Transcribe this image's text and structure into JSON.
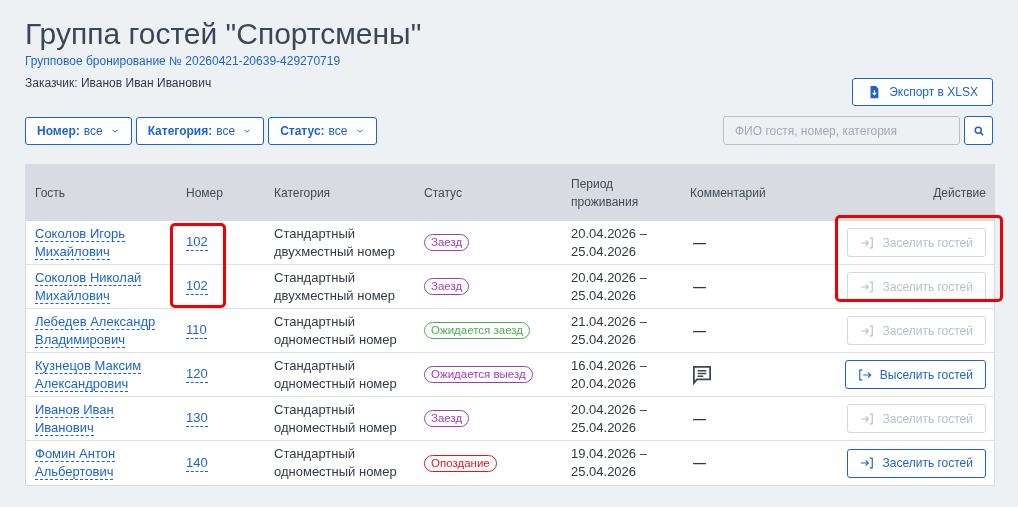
{
  "title": "Группа гостей \"Спортсмены\"",
  "booking_link": "Групповое бронирование № 20260421-20639-429270719",
  "customer": "Заказчик: Иванов Иван Иванович",
  "export_button": "Экспорт в XLSX",
  "filters": [
    {
      "label": "Номер:",
      "value": "все"
    },
    {
      "label": "Категория:",
      "value": "все"
    },
    {
      "label": "Статус:",
      "value": "все"
    }
  ],
  "search": {
    "placeholder": "ФИО гостя, номер, категория"
  },
  "table": {
    "columns": [
      "Гость",
      "Номер",
      "Категория",
      "Статус",
      "Период проживания",
      "Комментарий",
      "Действие"
    ],
    "rows": [
      {
        "guest": "Соколов Игорь Михайлович",
        "room": "102",
        "category": "Стандартный двухместный номер",
        "status": "Заезд",
        "color": "#a23cbf",
        "period": "20.04.2026 – 25.04.2026",
        "comment": {
          "kind": "dash",
          "text": "—"
        },
        "action": {
          "kind": "checkin",
          "label": "Заселить гостей",
          "disabled": true
        },
        "room_highlighted": true,
        "action_highlighted": true
      },
      {
        "guest": "Соколов Николай Михайлович",
        "room": "102",
        "category": "Стандартный двухместный номер",
        "status": "Заезд",
        "color": "#a23cbf",
        "period": "20.04.2026 – 25.04.2026",
        "comment": {
          "kind": "dash",
          "text": "—"
        },
        "action": {
          "kind": "checkin",
          "label": "Заселить гостей",
          "disabled": true
        },
        "room_highlighted": true,
        "action_highlighted": true
      },
      {
        "guest": "Лебедев Александр Владимирович",
        "room": "110",
        "category": "Стандартный одноместный номер",
        "status": "Ожидается заезд",
        "color": "#4caf50",
        "period": "21.04.2026 – 25.04.2026",
        "comment": {
          "kind": "dash",
          "text": "—"
        },
        "action": {
          "kind": "checkin",
          "label": "Заселить гостей",
          "disabled": true
        },
        "room_highlighted": false,
        "action_highlighted": false
      },
      {
        "guest": "Кузнецов Максим Александрович",
        "room": "120",
        "category": "Стандартный одноместный номер",
        "status": "Ожидается выезд",
        "color": "#a23cbf",
        "period": "16.04.2026 – 20.04.2026",
        "comment": {
          "kind": "icon"
        },
        "action": {
          "kind": "checkout",
          "label": "Выселить гостей",
          "disabled": false
        },
        "room_highlighted": false,
        "action_highlighted": false
      },
      {
        "guest": "Иванов Иван Иванович",
        "room": "130",
        "category": "Стандартный одноместный номер",
        "status": "Заезд",
        "color": "#a23cbf",
        "period": "20.04.2026 – 25.04.2026",
        "comment": {
          "kind": "dash",
          "text": "—"
        },
        "action": {
          "kind": "checkin",
          "label": "Заселить гостей",
          "disabled": true
        },
        "room_highlighted": false,
        "action_highlighted": false
      },
      {
        "guest": "Фомин Антон Альбертович",
        "room": "140",
        "category": "Стандартный одноместный номер",
        "status": "Опоздание",
        "color": "#e5161b",
        "period": "19.04.2026 – 25.04.2026",
        "comment": {
          "kind": "dash",
          "text": "—"
        },
        "action": {
          "kind": "checkin",
          "label": "Заселить гостей",
          "disabled": false
        },
        "room_highlighted": false,
        "action_highlighted": false
      }
    ]
  }
}
